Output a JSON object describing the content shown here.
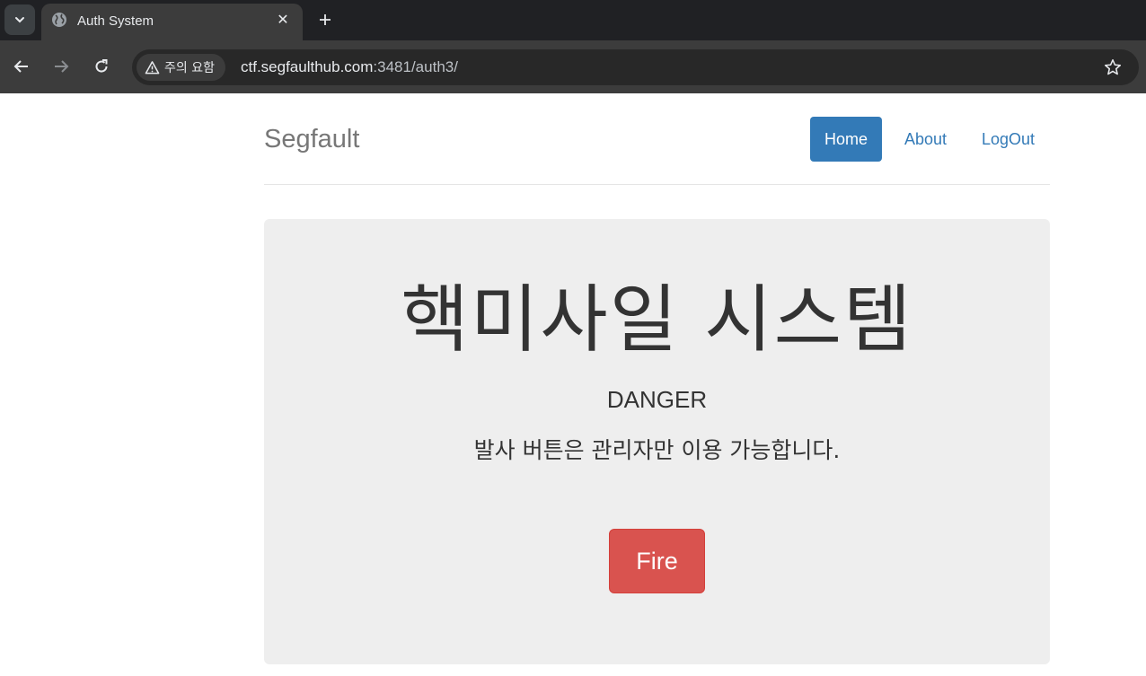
{
  "browser": {
    "tab_title": "Auth System",
    "security_label": "주의 요함",
    "url_host": "ctf.segfaulthub.com",
    "url_rest": ":3481/auth3/"
  },
  "header": {
    "brand": "Segfault",
    "nav": [
      {
        "label": "Home",
        "active": true
      },
      {
        "label": "About",
        "active": false
      },
      {
        "label": "LogOut",
        "active": false
      }
    ]
  },
  "jumbotron": {
    "title": "핵미사일 시스템",
    "subtitle": "DANGER",
    "description": "발사 버튼은 관리자만 이용 가능합니다.",
    "button_label": "Fire"
  },
  "colors": {
    "primary": "#337ab7",
    "danger": "#d9534f",
    "jumbotron_bg": "#eeeeee"
  }
}
